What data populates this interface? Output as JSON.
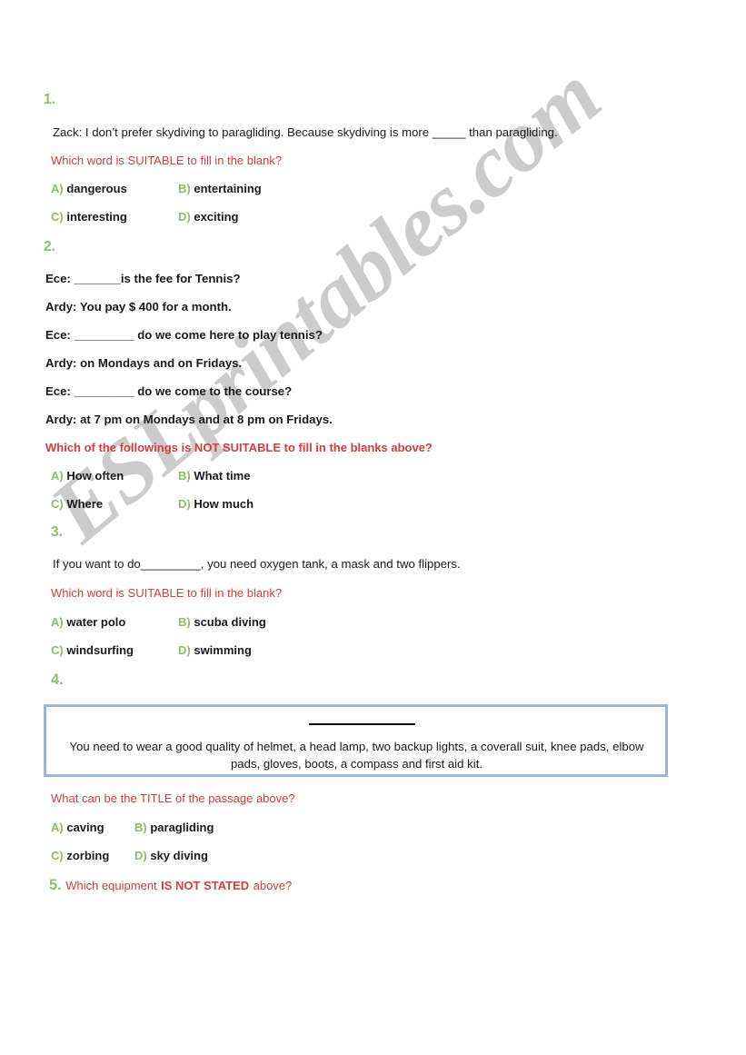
{
  "document": {
    "type": "esl-worksheet",
    "watermark": "ESLprintables.com",
    "colors": {
      "accent_green": "#8FBC6E",
      "prompt_red": "#D63C3C",
      "box_border_blue": "#9FB4D0",
      "text_black": "#1a1a1a",
      "watermark_gray": "#cccccc",
      "background": "#ffffff"
    }
  },
  "questions": [
    {
      "number": "1.",
      "stem": "Zack: I don’t prefer skydiving to paragliding. Because skydiving is more _____ than paragliding.",
      "prompt": "Which word is SUITABLE to fill in the blank?",
      "options": [
        {
          "letter": "A)",
          "text": "dangerous"
        },
        {
          "letter": "B)",
          "text": "entertaining"
        },
        {
          "letter": "C)",
          "text": "interesting"
        },
        {
          "letter": "D)",
          "text": "exciting"
        }
      ]
    },
    {
      "number": "2.",
      "dialogue": [
        "Ece: _______is the fee for Tennis?",
        "Ardy: You pay $ 400 for a month.",
        "Ece: _________ do we come here to play tennis?",
        "Ardy: on Mondays and on Fridays.",
        "Ece: _________ do we come to the course?",
        "Ardy: at 7 pm on Mondays and at 8 pm on Fridays."
      ],
      "prompt": "Which of the followings is NOT SUITABLE to fill in the blanks above?",
      "options": [
        {
          "letter": "A)",
          "text": "How often"
        },
        {
          "letter": "B)",
          "text": "What time"
        },
        {
          "letter": "C)",
          "text": "Where"
        },
        {
          "letter": "D)",
          "text": "How much"
        }
      ]
    },
    {
      "number": "3.",
      "stem": "If you want to do_________, you need oxygen tank, a mask and two flippers.",
      "prompt": "Which word is SUITABLE to fill in the blank?",
      "options": [
        {
          "letter": "A)",
          "text": "water polo"
        },
        {
          "letter": "B)",
          "text": "scuba diving"
        },
        {
          "letter": "C)",
          "text": "windsurfing"
        },
        {
          "letter": "D)",
          "text": "swimming"
        }
      ]
    },
    {
      "number": "4.",
      "passage": "You need to wear a good quality of helmet, a head lamp, two backup lights, a coverall suit, knee pads, elbow pads, gloves, boots, a compass and first aid kit.",
      "prompt": "What can be the TITLE of the passage above?",
      "options": [
        {
          "letter": "A)",
          "text": "caving"
        },
        {
          "letter": "B)",
          "text": "paragliding"
        },
        {
          "letter": "C)",
          "text": "zorbing"
        },
        {
          "letter": "D)",
          "text": "sky diving"
        }
      ]
    },
    {
      "number": "5.",
      "question_lead": "Which equipment",
      "question_emphasis": "IS NOT STATED",
      "question_tail": "above?"
    }
  ]
}
